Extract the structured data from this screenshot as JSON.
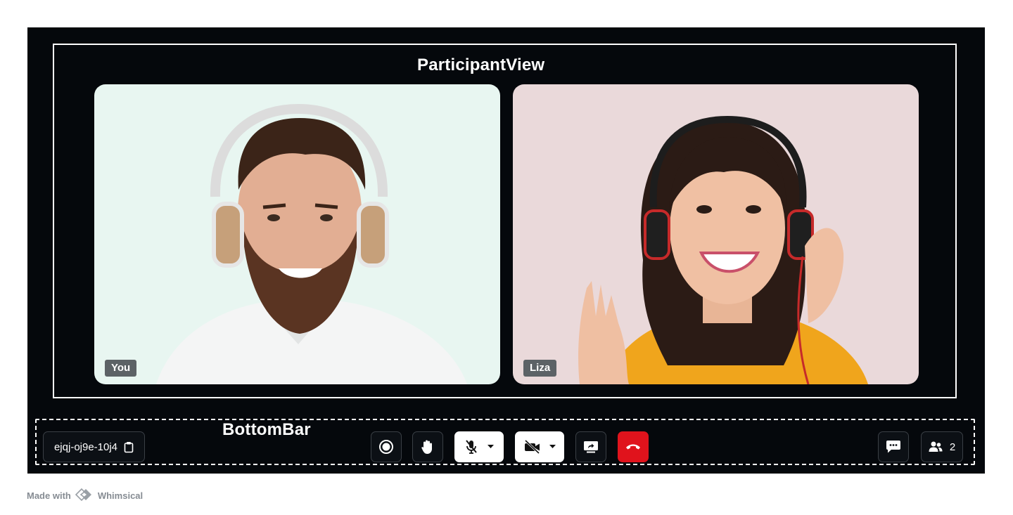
{
  "participant_view": {
    "section_label": "ParticipantView",
    "tiles": [
      {
        "name": "You",
        "background": "#e8f6f1"
      },
      {
        "name": "Liza",
        "background": "#ead9da"
      }
    ]
  },
  "bottom_bar": {
    "section_label": "BottomBar",
    "meeting_id": "ejqj-oj9e-10j4",
    "participant_count": "2",
    "controls": [
      "record-icon",
      "raise-hand-icon",
      "mic-off-icon",
      "camera-off-icon",
      "screen-share-icon",
      "end-call-icon",
      "chat-icon",
      "participants-icon"
    ]
  },
  "footer": {
    "made_with": "Made with",
    "brand": "Whimsical"
  },
  "colors": {
    "stage": "#05080c",
    "end_call": "#e0131c",
    "name_tag": "#5c6266"
  }
}
